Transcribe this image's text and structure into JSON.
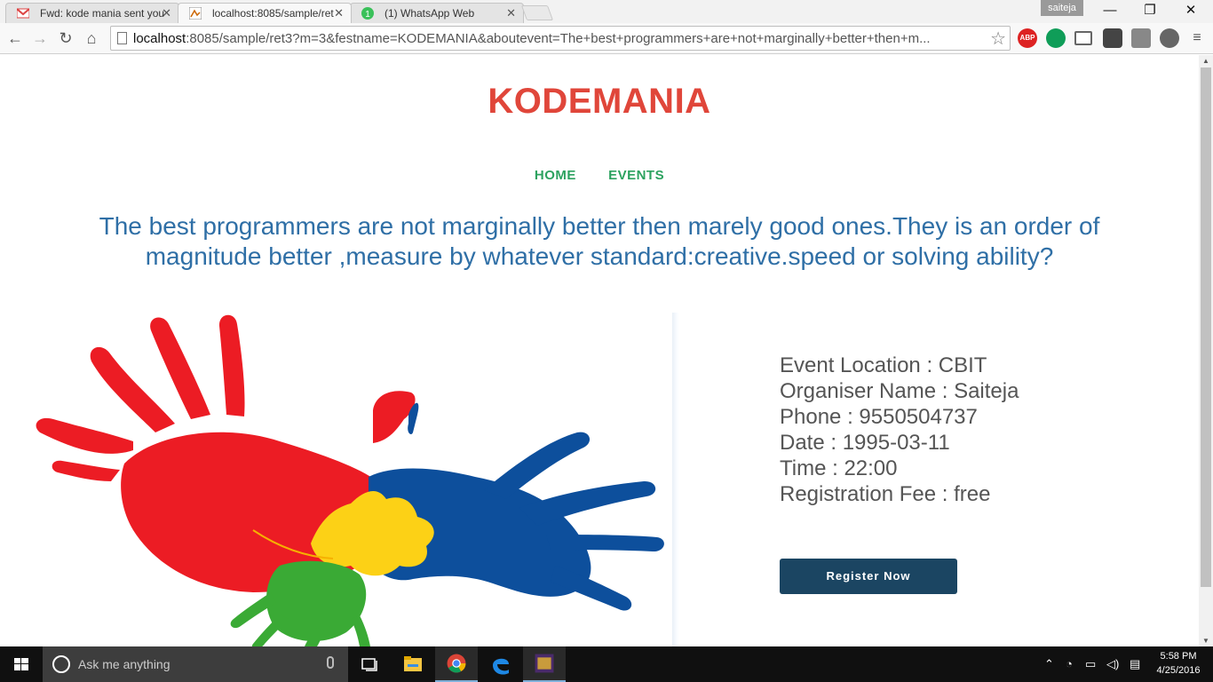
{
  "browser": {
    "tabs": [
      {
        "title": "Fwd: kode mania sent you",
        "icon": "gmail-icon",
        "active": false
      },
      {
        "title": "localhost:8085/sample/ret",
        "icon": "page-favicon",
        "active": true
      },
      {
        "title": "(1) WhatsApp Web",
        "icon": "whatsapp-icon",
        "active": false
      }
    ],
    "profile_name": "saiteja",
    "url_host": "localhost",
    "url_rest": ":8085/sample/ret3?m=3&festname=KODEMANIA&aboutevent=The+best+programmers+are+not+marginally+better+then+m...",
    "extensions": [
      "ABP",
      "hangouts",
      "cast",
      "ext1",
      "drive",
      "ext2"
    ]
  },
  "page": {
    "site_title": "KODEMANIA",
    "nav": {
      "home": "HOME",
      "events": "EVENTS"
    },
    "tagline": "The best programmers are not marginally better then marely good ones.They is an order of magnitude better ,measure by whatever standard:creative.speed or solving ability?",
    "details": [
      "Event Location : CBIT",
      "Organiser Name : Saiteja",
      "Phone : 9550504737",
      "Date : 1995-03-11",
      "Time : 22:00",
      "Registration Fee : free"
    ],
    "register_label": "Register Now",
    "colors": {
      "title": "#e0463a",
      "nav": "#2ca25f",
      "tagline": "#2f6fa6",
      "button": "#1b4562"
    }
  },
  "taskbar": {
    "search_placeholder": "Ask me anything",
    "time": "5:58 PM",
    "date": "4/25/2016"
  }
}
